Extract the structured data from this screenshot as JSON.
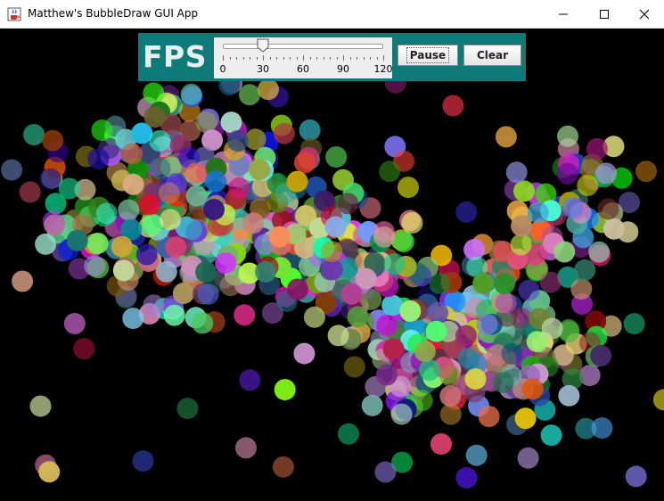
{
  "window": {
    "title": "Matthew's BubbleDraw GUI App",
    "icon": "java-coffee-cup-icon",
    "controls": [
      "minimize-icon",
      "maximize-icon",
      "close-icon"
    ]
  },
  "toolbar": {
    "fps_label": "FPS",
    "slider": {
      "value": 30,
      "min": 0,
      "max": 120,
      "major_tick_labels": [
        "0",
        "30",
        "60",
        "90",
        "120"
      ]
    },
    "pause_label": "Pause",
    "clear_label": "Clear",
    "panel_color": "#0f7a7a"
  },
  "canvas": {
    "background": "#000000"
  }
}
